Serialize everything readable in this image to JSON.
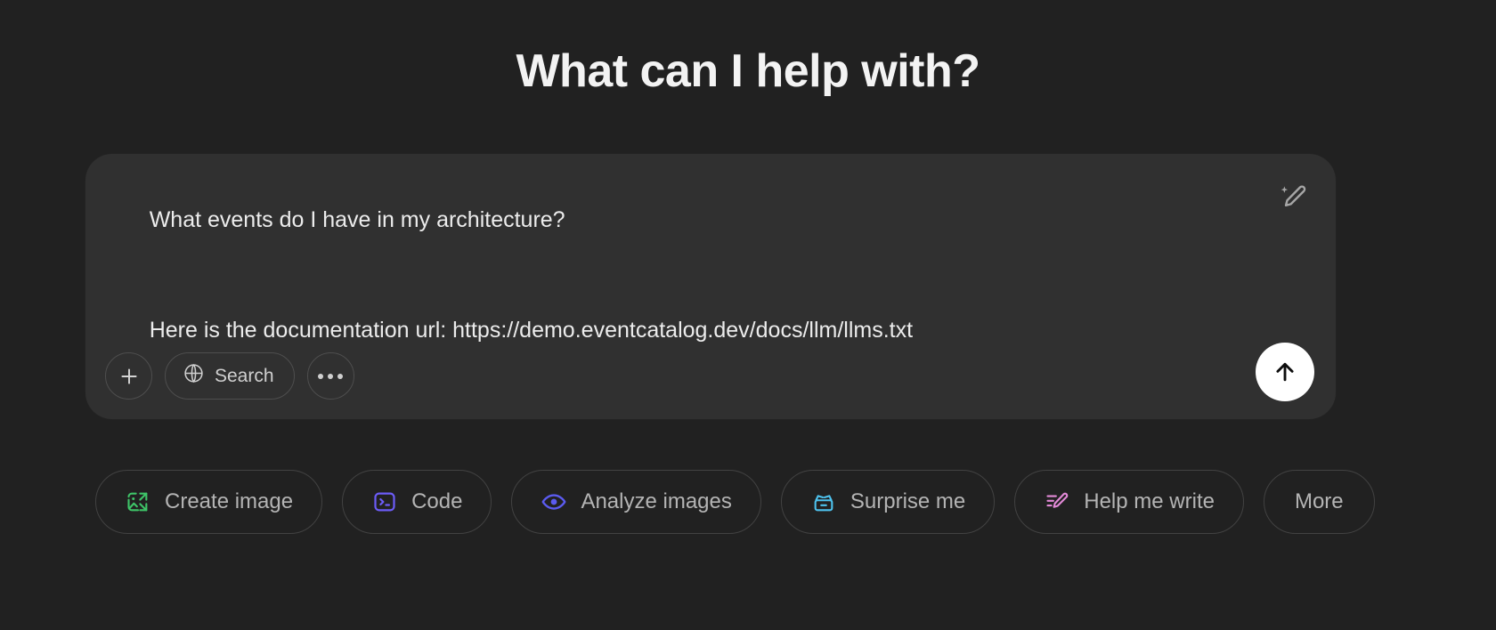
{
  "header": {
    "title": "What can I help with?"
  },
  "composer": {
    "message_line_1": "What events do I have in my architecture?",
    "message_line_2": "Here is the documentation url: https://demo.eventcatalog.dev/docs/llm/llms.txt",
    "edit_icon": "sparkle-pencil-icon",
    "attach_icon": "plus-icon",
    "search_label": "Search",
    "search_icon": "globe-icon",
    "more_tools_icon": "ellipsis-icon",
    "send_icon": "arrow-up-icon",
    "background_color": "#303030"
  },
  "suggestions": [
    {
      "label": "Create image",
      "icon": "image-shuffle-icon",
      "color": "#3ec468"
    },
    {
      "label": "Code",
      "icon": "terminal-icon",
      "color": "#6c5cf7"
    },
    {
      "label": "Analyze images",
      "icon": "eye-icon",
      "color": "#5b5bf0"
    },
    {
      "label": "Surprise me",
      "icon": "gift-box-icon",
      "color": "#4ec3ef"
    },
    {
      "label": "Help me write",
      "icon": "pencil-lines-icon",
      "color": "#e48ad8"
    },
    {
      "label": "More",
      "icon": "",
      "color": ""
    }
  ],
  "theme": {
    "page_background": "#212121",
    "text_primary": "#ececec",
    "text_muted": "#b4b4b4",
    "send_button_background": "#ffffff"
  }
}
